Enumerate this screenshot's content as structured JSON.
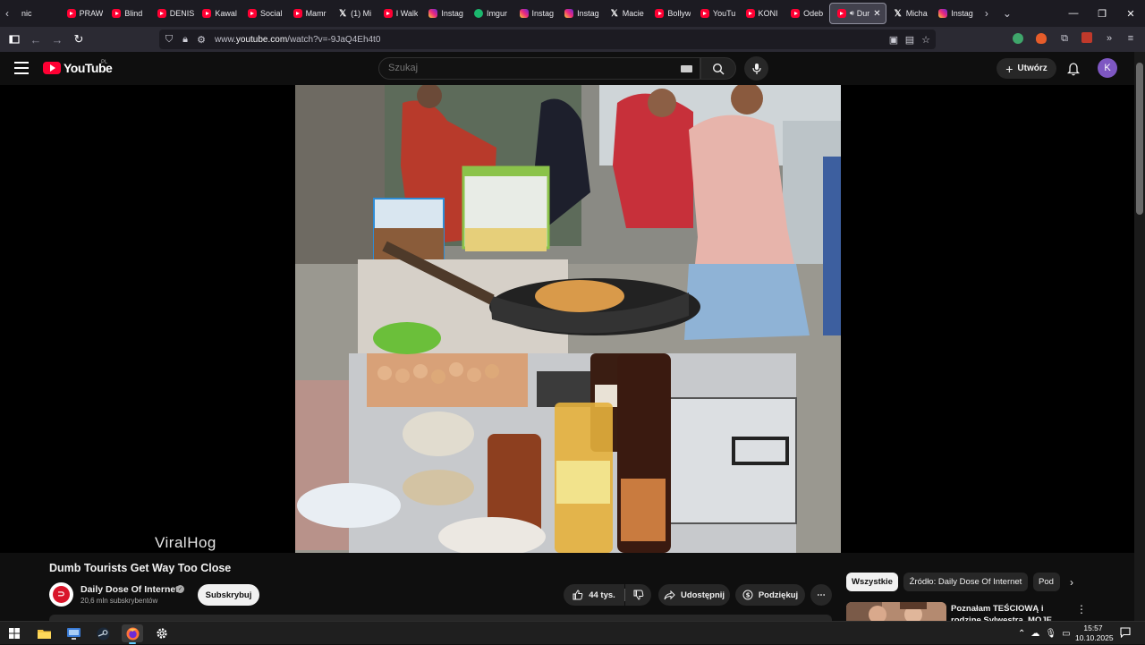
{
  "browser": {
    "tabs": [
      {
        "label": "nic",
        "icon": "none"
      },
      {
        "label": "PRAW",
        "icon": "youtube-icon"
      },
      {
        "label": "Blind",
        "icon": "youtube-icon"
      },
      {
        "label": "DENIS",
        "icon": "youtube-icon"
      },
      {
        "label": "Kawal",
        "icon": "youtube-icon"
      },
      {
        "label": "Social",
        "icon": "youtube-icon"
      },
      {
        "label": "Mamr",
        "icon": "youtube-icon"
      },
      {
        "label": "(1) Mi",
        "icon": "x-icon"
      },
      {
        "label": "I Walk",
        "icon": "youtube-icon"
      },
      {
        "label": "Instag",
        "icon": "instagram-icon"
      },
      {
        "label": "Imgur",
        "icon": "imgur-icon"
      },
      {
        "label": "Instag",
        "icon": "instagram-icon"
      },
      {
        "label": "Instag",
        "icon": "instagram-icon"
      },
      {
        "label": "Macie",
        "icon": "x-icon"
      },
      {
        "label": "Bollyw",
        "icon": "youtube-icon"
      },
      {
        "label": "YouTu",
        "icon": "youtube-icon"
      },
      {
        "label": "KONI",
        "icon": "youtube-icon"
      },
      {
        "label": "Odeb",
        "icon": "youtube-icon"
      },
      {
        "label": "Dur",
        "icon": "youtube-icon",
        "active": true
      },
      {
        "label": "Micha",
        "icon": "x-icon"
      },
      {
        "label": "Instag",
        "icon": "instagram-icon"
      }
    ],
    "url_prefix": "www.",
    "url_domain": "youtube.com",
    "url_path": "/watch?v=-9JaQ4Eh4t0"
  },
  "youtube": {
    "logo_text": "YouTube",
    "region": "PL",
    "search_placeholder": "Szukaj",
    "create_label": "Utwórz",
    "avatar_letter": "K"
  },
  "video": {
    "watermark": "ViralHog",
    "title": "Dumb Tourists Get Way Too Close",
    "channel_name": "Daily Dose Of Internet",
    "channel_subs": "20,6 mln subskrybentów",
    "subscribe_label": "Subskrybuj",
    "likes": "44 tys.",
    "share_label": "Udostępnij",
    "thanks_label": "Podziękuj"
  },
  "sidebar": {
    "chips": [
      "Wszystkie",
      "Źródło: Daily Dose Of Internet",
      "Pod"
    ],
    "rec_title": "Poznałam TEŚCIOWĄ i rodzinę Sylwestra. MOJE URODZINY I"
  },
  "taskbar": {
    "time": "15:57",
    "date": "10.10.2025"
  },
  "colors": {
    "youtube_red": "#ff0033",
    "background": "#0f0f0f",
    "avatar": "#7e57c2"
  }
}
